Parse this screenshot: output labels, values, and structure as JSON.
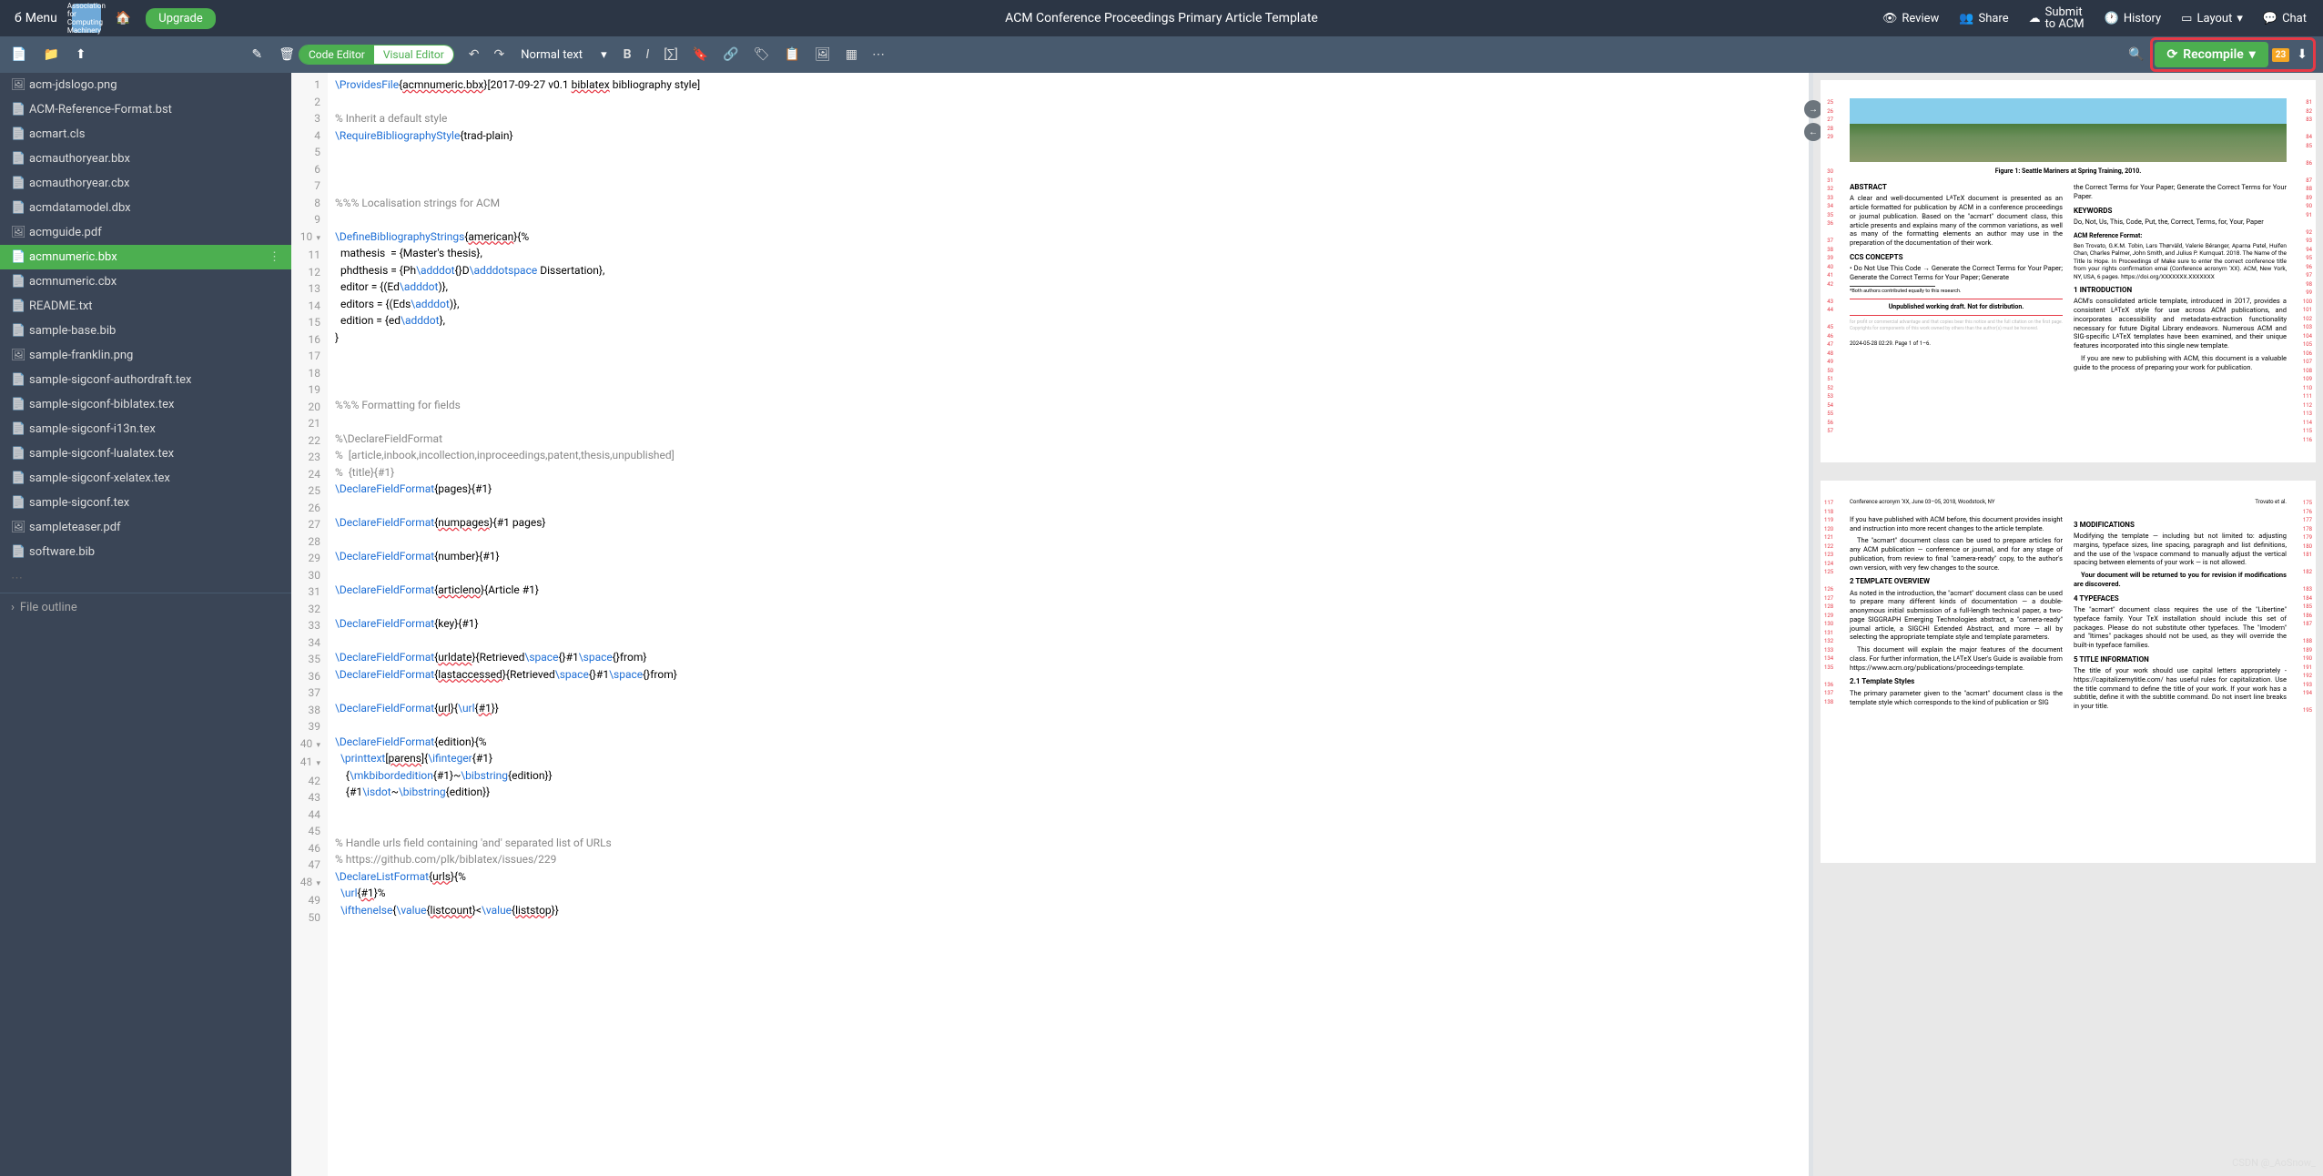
{
  "topbar": {
    "menu": "Menu",
    "logo_title": "Association for Computing Machinery",
    "upgrade": "Upgrade",
    "title": "ACM Conference Proceedings Primary Article Template",
    "review": "Review",
    "share": "Share",
    "submit1": "Submit",
    "submit2": "to ACM",
    "history": "History",
    "layout": "Layout",
    "chat": "Chat"
  },
  "toolbar": {
    "code_editor": "Code Editor",
    "visual_editor": "Visual Editor",
    "format": "Normal text",
    "recompile": "Recompile",
    "badge": "23"
  },
  "files": [
    {
      "name": "acm-jdslogo.png",
      "icon": "🖼"
    },
    {
      "name": "ACM-Reference-Format.bst",
      "icon": "📄"
    },
    {
      "name": "acmart.cls",
      "icon": "📄"
    },
    {
      "name": "acmauthoryear.bbx",
      "icon": "📄"
    },
    {
      "name": "acmauthoryear.cbx",
      "icon": "📄"
    },
    {
      "name": "acmdatamodel.dbx",
      "icon": "📄"
    },
    {
      "name": "acmguide.pdf",
      "icon": "🖼"
    },
    {
      "name": "acmnumeric.bbx",
      "icon": "📄",
      "selected": true
    },
    {
      "name": "acmnumeric.cbx",
      "icon": "📄"
    },
    {
      "name": "README.txt",
      "icon": "📄"
    },
    {
      "name": "sample-base.bib",
      "icon": "📄"
    },
    {
      "name": "sample-franklin.png",
      "icon": "🖼"
    },
    {
      "name": "sample-sigconf-authordraft.tex",
      "icon": "📄"
    },
    {
      "name": "sample-sigconf-biblatex.tex",
      "icon": "📄"
    },
    {
      "name": "sample-sigconf-i13n.tex",
      "icon": "📄"
    },
    {
      "name": "sample-sigconf-lualatex.tex",
      "icon": "📄"
    },
    {
      "name": "sample-sigconf-xelatex.tex",
      "icon": "📄"
    },
    {
      "name": "sample-sigconf.tex",
      "icon": "📄"
    },
    {
      "name": "sampleteaser.pdf",
      "icon": "🖼"
    },
    {
      "name": "software.bib",
      "icon": "📄"
    }
  ],
  "outline": "File outline",
  "code_lines": [
    {
      "n": 1,
      "h": "<span class='tok-cmd'>\\ProvidesFile</span>{<span class='tok-err'>acmnumeric.bbx</span>}[2017-09-27 v0.1 <span class='tok-err'>biblatex</span> bibliography style]"
    },
    {
      "n": 2,
      "h": ""
    },
    {
      "n": 3,
      "h": "<span class='tok-comment'>% Inherit a default style</span>"
    },
    {
      "n": 4,
      "h": "<span class='tok-cmd'>\\RequireBibliographyStyle</span>{trad-plain}"
    },
    {
      "n": 5,
      "h": ""
    },
    {
      "n": 6,
      "h": ""
    },
    {
      "n": 7,
      "h": ""
    },
    {
      "n": 8,
      "h": "<span class='tok-comment'>%%% Localisation strings for ACM</span>"
    },
    {
      "n": 9,
      "h": ""
    },
    {
      "n": 10,
      "fold": true,
      "h": "<span class='tok-cmd'>\\DefineBibliographyStrings</span>{<span class='tok-err'>american</span>}{%"
    },
    {
      "n": 11,
      "h": "  mathesis  = {Master's thesis},"
    },
    {
      "n": 12,
      "h": "  phdthesis = {Ph<span class='tok-cmd'>\\adddot</span>{}D<span class='tok-cmd'>\\adddotspace</span> Dissertation},"
    },
    {
      "n": 13,
      "h": "  editor = {(Ed<span class='tok-cmd'>\\adddot</span>)},"
    },
    {
      "n": 14,
      "h": "  editors = {(Eds<span class='tok-cmd'>\\adddot</span>)},"
    },
    {
      "n": 15,
      "h": "  edition = {ed<span class='tok-cmd'>\\adddot</span>},"
    },
    {
      "n": 16,
      "h": "}"
    },
    {
      "n": 17,
      "h": ""
    },
    {
      "n": 18,
      "h": ""
    },
    {
      "n": 19,
      "h": ""
    },
    {
      "n": 20,
      "h": "<span class='tok-comment'>%%% Formatting for fields</span>"
    },
    {
      "n": 21,
      "h": ""
    },
    {
      "n": 22,
      "h": "<span class='tok-comment'>%\\DeclareFieldFormat</span>"
    },
    {
      "n": 23,
      "h": "<span class='tok-comment'>%  [article,inbook,incollection,inproceedings,patent,thesis,unpublished]</span>"
    },
    {
      "n": 24,
      "h": "<span class='tok-comment'>%  {title}{#1}</span>"
    },
    {
      "n": 25,
      "h": "<span class='tok-cmd'>\\DeclareFieldFormat</span>{pages}{#1}"
    },
    {
      "n": 26,
      "h": ""
    },
    {
      "n": 27,
      "h": "<span class='tok-cmd'>\\DeclareFieldFormat</span>{<span class='tok-err'>numpages</span>}{#1 pages}"
    },
    {
      "n": 28,
      "h": ""
    },
    {
      "n": 29,
      "h": "<span class='tok-cmd'>\\DeclareFieldFormat</span>{number}{#1}"
    },
    {
      "n": 30,
      "h": ""
    },
    {
      "n": 31,
      "h": "<span class='tok-cmd'>\\DeclareFieldFormat</span>{<span class='tok-err'>articleno</span>}{Article #1}"
    },
    {
      "n": 32,
      "h": ""
    },
    {
      "n": 33,
      "h": "<span class='tok-cmd'>\\DeclareFieldFormat</span>{key}{#1}"
    },
    {
      "n": 34,
      "h": ""
    },
    {
      "n": 35,
      "h": "<span class='tok-cmd'>\\DeclareFieldFormat</span>{<span class='tok-err'>urldate</span>}{Retrieved<span class='tok-cmd'>\\space</span>{}#1<span class='tok-cmd'>\\space</span>{}from}"
    },
    {
      "n": 36,
      "h": "<span class='tok-cmd'>\\DeclareFieldFormat</span>{<span class='tok-err'>lastaccessed</span>}{Retrieved<span class='tok-cmd'>\\space</span>{}#1<span class='tok-cmd'>\\space</span>{}from}"
    },
    {
      "n": 37,
      "h": ""
    },
    {
      "n": 38,
      "h": "<span class='tok-cmd'>\\DeclareFieldFormat</span>{<span class='tok-err'>url</span>}{<span class='tok-cmd'>\\url</span>{<span class='tok-err'>#1</span>}}"
    },
    {
      "n": 39,
      "h": ""
    },
    {
      "n": 40,
      "fold": true,
      "h": "<span class='tok-cmd'>\\DeclareFieldFormat</span>{edition}{%"
    },
    {
      "n": 41,
      "fold": true,
      "h": "  <span class='tok-cmd'>\\printtext</span>[<span class='tok-err'>parens</span>]{<span class='tok-cmd'>\\ifinteger</span>{#1}"
    },
    {
      "n": 42,
      "h": "    {<span class='tok-cmd'>\\mkbibordedition</span>{#1}~<span class='tok-cmd'>\\bibstring</span>{edition}}"
    },
    {
      "n": 43,
      "h": "    {#1<span class='tok-cmd'>\\isdot</span>~<span class='tok-cmd'>\\bibstring</span>{edition}}"
    },
    {
      "n": 44,
      "h": ""
    },
    {
      "n": 45,
      "h": ""
    },
    {
      "n": 46,
      "h": "<span class='tok-comment'>% Handle urls field containing 'and' separated list of URLs</span>"
    },
    {
      "n": 47,
      "h": "<span class='tok-comment'>% https://github.com/plk/biblatex/issues/229</span>"
    },
    {
      "n": 48,
      "fold": true,
      "h": "<span class='tok-cmd'>\\DeclareListFormat</span>{<span class='tok-err'>urls</span>}{%"
    },
    {
      "n": 49,
      "h": "  <span class='tok-cmd'>\\url</span>{<span class='tok-err'>#1</span>}%"
    },
    {
      "n": 50,
      "h": "  <span class='tok-cmd'>\\ifthenelse</span>{<span class='tok-cmd'>\\value</span>{<span class='tok-err'>listcount</span>}&lt;<span class='tok-cmd'>\\value</span>{<span class='tok-err'>liststop</span>}}"
    }
  ],
  "preview": {
    "p1": {
      "left_nums": [
        "25",
        "26",
        "27",
        "28",
        "29",
        "",
        "",
        "",
        "30",
        "31",
        "32",
        "33",
        "34",
        "35",
        "36",
        "",
        "37",
        "38",
        "39",
        "40",
        "41",
        "42",
        "",
        "43",
        "44",
        "",
        "45",
        "46",
        "47",
        "48",
        "49",
        "50",
        "51",
        "52",
        "53",
        "54",
        "55",
        "56",
        "57"
      ],
      "right_nums": [
        "81",
        "82",
        "83",
        "",
        "84",
        "85",
        "",
        "86",
        "",
        "87",
        "88",
        "89",
        "90",
        "91",
        "",
        "92",
        "93",
        "94",
        "95",
        "96",
        "97",
        "98",
        "99",
        "100",
        "101",
        "102",
        "103",
        "104",
        "105",
        "106",
        "107",
        "108",
        "109",
        "110",
        "111",
        "112",
        "113",
        "114",
        "115",
        "116"
      ],
      "fig_caption": "Figure 1: Seattle Mariners at Spring Training, 2010.",
      "abstract_h": "ABSTRACT",
      "abstract": "A clear and well-documented LᴬTᴇX document is presented as an article formatted for publication by ACM in a conference proceedings or journal publication. Based on the \"acmart\" document class, this article presents and explains many of the common variations, as well as many of the formatting elements an author may use in the preparation of the documentation of their work.",
      "ccs_h": "CCS CONCEPTS",
      "ccs": "• Do Not Use This Code → Generate the Correct Terms for Your Paper; Generate the Correct Terms for Your Paper; Generate",
      "footnote": "*Both authors contributed equally to this research.",
      "wm": "Unpublished working draft. Not for distribution.",
      "correct": "the Correct Terms for Your Paper; Generate the Correct Terms for Your Paper.",
      "kw_h": "KEYWORDS",
      "kw": "Do, Not, Us, This, Code, Put, the, Correct, Terms, for, Your, Paper",
      "ref_h": "ACM Reference Format:",
      "ref": "Ben Trovato, G.K.M. Tobin, Lars Thørväld, Valerie Béranger, Aparna Patel, Huifen Chan, Charles Palmer, John Smith, and Julius P. Kumquat. 2018. The Name of the Title Is Hope. In Proceedings of Make sure to enter the correct conference title from your rights confirmation emai (Conference acronym 'XX). ACM, New York, NY, USA, 6 pages. https://doi.org/XXXXXXX.XXXXXXX",
      "intro_h": "1   INTRODUCTION",
      "intro1": "ACM's consolidated article template, introduced in 2017, provides a consistent LᴬTᴇX style for use across ACM publications, and incorporates accessibility and metadata-extraction functionality necessary for future Digital Library endeavors. Numerous ACM and SIG-specific LᴬTᴇX templates have been examined, and their unique features incorporated into this single new template.",
      "intro2": "If you are new to publishing with ACM, this document is a valuable guide to the process of preparing your work for publication.",
      "pager": "2024-05-28 02:29. Page 1 of 1–6."
    },
    "p2": {
      "left_nums": [
        "117",
        "118",
        "119",
        "120",
        "121",
        "122",
        "123",
        "124",
        "125",
        "",
        "126",
        "127",
        "128",
        "129",
        "130",
        "131",
        "132",
        "133",
        "134",
        "135",
        "",
        "136",
        "137",
        "138"
      ],
      "right_nums": [
        "175",
        "176",
        "177",
        "178",
        "179",
        "180",
        "181",
        "",
        "182",
        "",
        "183",
        "184",
        "185",
        "186",
        "187",
        "",
        "188",
        "189",
        "190",
        "191",
        "192",
        "193",
        "194",
        "",
        "195"
      ],
      "header_l": "Conference acronym 'XX, June 03–05, 2018, Woodstock, NY",
      "header_r": "Trovato et al.",
      "p_mod1": "If you have published with ACM before, this document provides insight and instruction into more recent changes to the article template.",
      "p_mod2": "The \"acmart\" document class can be used to prepare articles for any ACM publication — conference or journal, and for any stage of publication, from review to final \"camera-ready\" copy, to the author's own version, with very few changes to the source.",
      "tmpl_h": "2   TEMPLATE OVERVIEW",
      "tmpl1": "As noted in the introduction, the \"acmart\" document class can be used to prepare many different kinds of documentation — a double-anonymous initial submission of a full-length technical paper, a two-page SIGGRAPH Emerging Technologies abstract, a \"camera-ready\" journal article, a SIGCHI Extended Abstract, and more — all by selecting the appropriate template style and template parameters.",
      "tmpl2": "This document will explain the major features of the document class. For further information, the LᴬTᴇX User's Guide is available from https://www.acm.org/publications/proceedings-template.",
      "styles_h": "2.1   Template Styles",
      "styles": "The primary parameter given to the \"acmart\" document class is the template style which corresponds to the kind of publication or SIG",
      "mods_h": "3   MODIFICATIONS",
      "mods1": "Modifying the template — including but not limited to: adjusting margins, typeface sizes, line spacing, paragraph and list definitions, and the use of the \\vspace command to manually adjust the vertical spacing between elements of your work — is not allowed.",
      "mods2": "Your document will be returned to you for revision if modifications are discovered.",
      "type_h": "4   TYPEFACES",
      "type": "The \"acmart\" document class requires the use of the \"Libertine\" typeface family. Your TᴇX installation should include this set of packages. Please do not substitute other typefaces. The \"lmodern\" and \"ltimes\" packages should not be used, as they will override the built-in typeface families.",
      "ti_h": "5   TITLE INFORMATION",
      "ti": "The title of your work should use capital letters appropriately - https://capitalizemytitle.com/ has useful rules for capitalization. Use the title command to define the title of your work. If your work has a subtitle, define it with the subtitle command. Do not insert line breaks in your title."
    }
  },
  "watermark": "CSDN @_AoSnow_"
}
